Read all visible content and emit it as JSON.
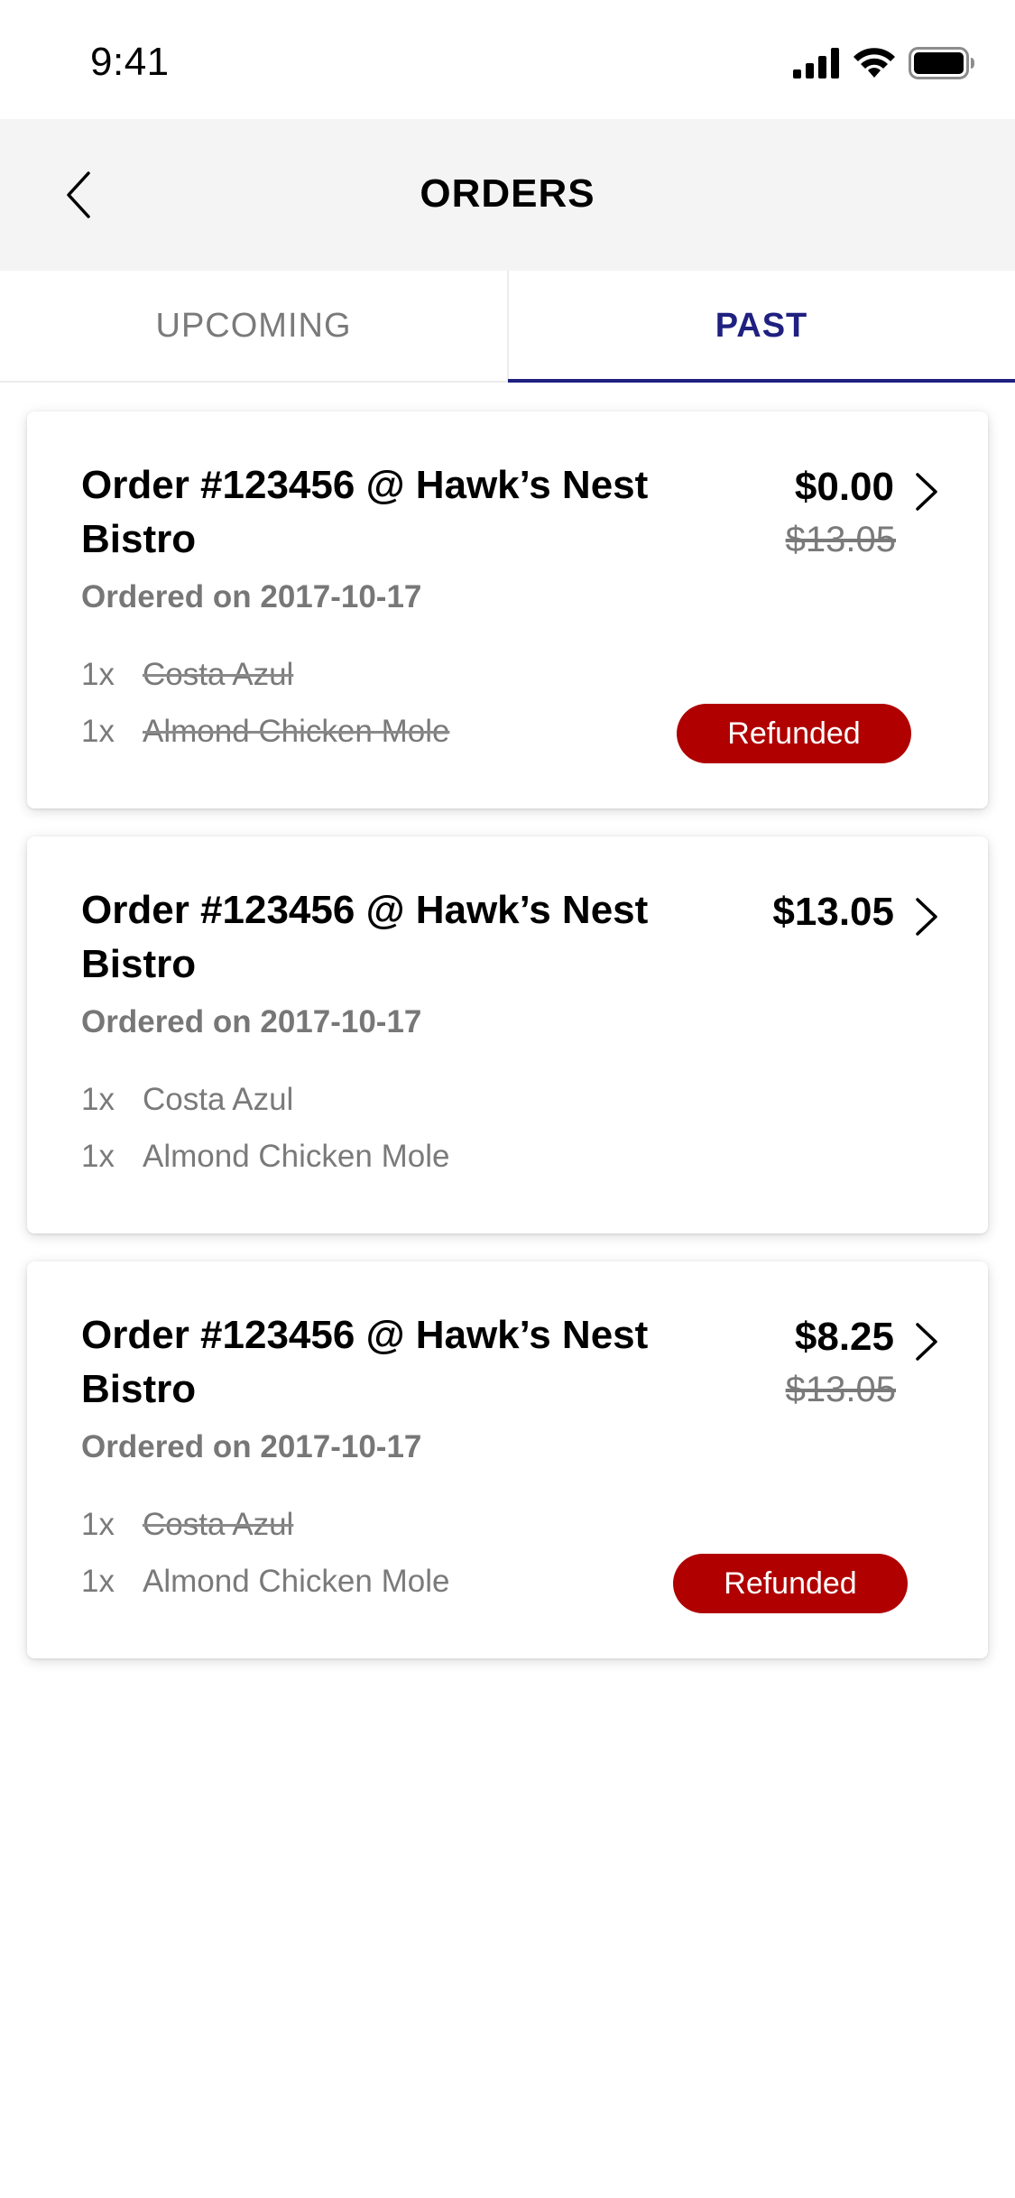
{
  "status_bar": {
    "time": "9:41"
  },
  "nav": {
    "title": "ORDERS"
  },
  "tabs": [
    {
      "label": "UPCOMING",
      "active": false
    },
    {
      "label": "PAST",
      "active": true
    }
  ],
  "colors": {
    "accent": "#1f2080",
    "refund": "#b00000",
    "muted": "#7a7a7a",
    "nav_bg": "#f4f4f4"
  },
  "orders": [
    {
      "title": "Order #123456 @ Hawk’s Nest Bistro",
      "price": "$0.00",
      "original_price": "$13.05",
      "date": "Ordered on 2017-10-17",
      "items": [
        {
          "qty": "1x",
          "name": "Costa Azul",
          "refunded": true
        },
        {
          "qty": "1x",
          "name": "Almond Chicken Mole",
          "refunded": true
        }
      ],
      "badge": "Refunded"
    },
    {
      "title": "Order #123456 @ Hawk’s Nest Bistro",
      "price": "$13.05",
      "date": "Ordered on 2017-10-17",
      "items": [
        {
          "qty": "1x",
          "name": "Costa Azul",
          "refunded": false
        },
        {
          "qty": "1x",
          "name": "Almond Chicken Mole",
          "refunded": false
        }
      ]
    },
    {
      "title": "Order #123456 @ Hawk’s Nest Bistro",
      "price": "$8.25",
      "original_price": "$13.05",
      "date": "Ordered on 2017-10-17",
      "items": [
        {
          "qty": "1x",
          "name": "Costa Azul",
          "refunded": true
        },
        {
          "qty": "1x",
          "name": "Almond Chicken Mole",
          "refunded": false
        }
      ],
      "badge": "Refunded"
    }
  ]
}
